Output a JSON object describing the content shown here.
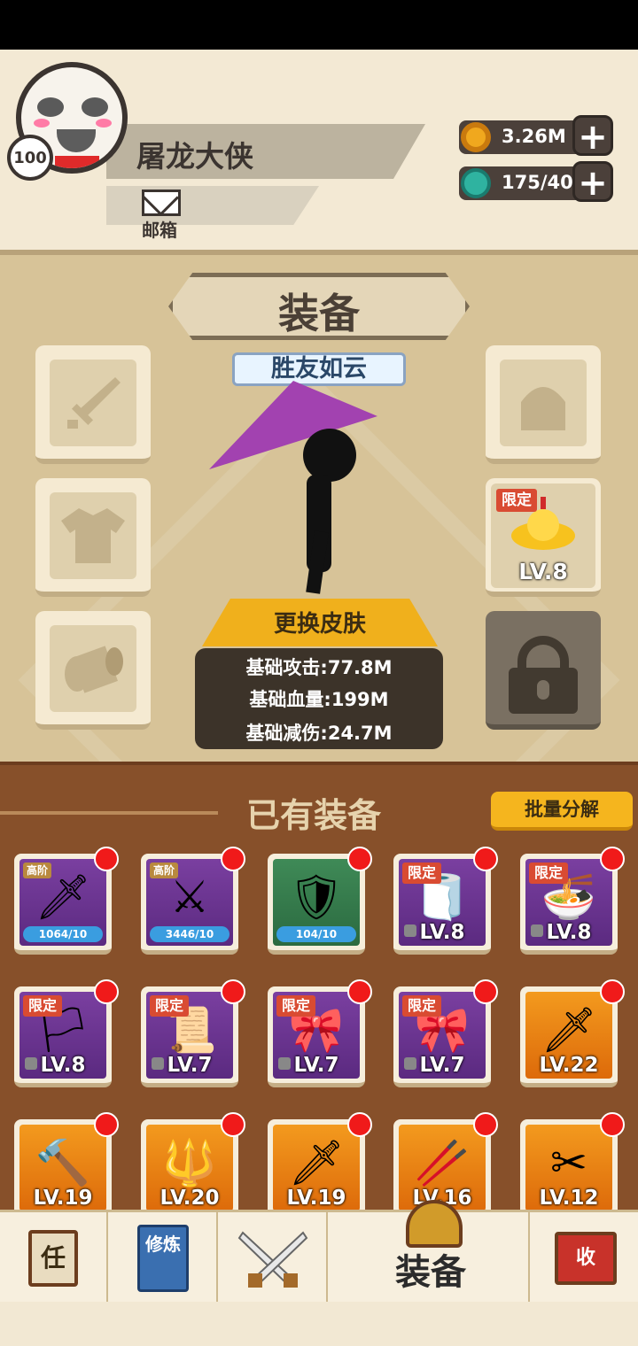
{
  "player": {
    "name": "屠龙大侠",
    "level": "100",
    "mail_label": "邮箱"
  },
  "resources": {
    "gold": "3.26M",
    "gem": "175/40",
    "gold_color": "#f0a81e",
    "gem_color": "#2fb3a0"
  },
  "equip_panel": {
    "title": "装备",
    "skin_name": "胜友如云",
    "change_skin_label": "更换皮肤",
    "stats": [
      "基础攻击:77.8M",
      "基础血量:199M",
      "基础减伤:24.7M"
    ],
    "left_slots": [
      "sword-icon",
      "shirt-icon",
      "bracer-icon"
    ],
    "right_slots": [
      {
        "icon": "helmet-icon",
        "empty": true
      },
      {
        "icon": "gold-ingot-icon",
        "tag": "限定",
        "level": "LV.8"
      },
      {
        "icon": "lock-icon",
        "locked": true
      }
    ]
  },
  "owned": {
    "title": "已有装备",
    "bulk_label": "批量分解",
    "items": [
      {
        "icon": "sword-icon",
        "bg": "purple",
        "tag": "高阶",
        "bar": "1064/10"
      },
      {
        "icon": "blade-icon",
        "bg": "purple",
        "tag": "高阶",
        "bar": "3446/10"
      },
      {
        "icon": "armor-icon",
        "bg": "green",
        "tag": "",
        "bar": "104/10"
      },
      {
        "icon": "toilet-roll-icon",
        "bg": "purple",
        "tag": "限定",
        "level": "LV.8"
      },
      {
        "icon": "noodle-cup-icon",
        "bg": "purple",
        "tag": "限定",
        "level": "LV.8"
      },
      {
        "icon": "banner-icon",
        "bg": "purple",
        "tag": "限定",
        "level": "LV.8"
      },
      {
        "icon": "scroll-icon",
        "bg": "purple",
        "tag": "限定",
        "level": "LV.7"
      },
      {
        "icon": "chinese-knot-icon",
        "bg": "purple",
        "tag": "限定",
        "level": "LV.7"
      },
      {
        "icon": "chinese-knot-icon",
        "bg": "purple",
        "tag": "限定",
        "level": "LV.7"
      },
      {
        "icon": "golden-saber-icon",
        "bg": "orange",
        "tag": "",
        "level": "LV.22"
      },
      {
        "icon": "mace-icon",
        "bg": "orange",
        "tag": "",
        "level": "LV.19"
      },
      {
        "icon": "trident-icon",
        "bg": "orange",
        "tag": "",
        "level": "LV.20"
      },
      {
        "icon": "long-sword-icon",
        "bg": "orange",
        "tag": "",
        "level": "LV.19"
      },
      {
        "icon": "staff-icon",
        "bg": "orange",
        "tag": "",
        "level": "LV.16"
      },
      {
        "icon": "scissors-icon",
        "bg": "orange",
        "tag": "",
        "level": "LV.12"
      }
    ]
  },
  "nav": {
    "tab1_icon": "task-scroll-icon",
    "tab1_glyph": "任",
    "tab2_glyph": "修炼",
    "tab3_icon": "crossed-swords-icon",
    "active_label": "装备",
    "tab5_glyph": "收"
  }
}
